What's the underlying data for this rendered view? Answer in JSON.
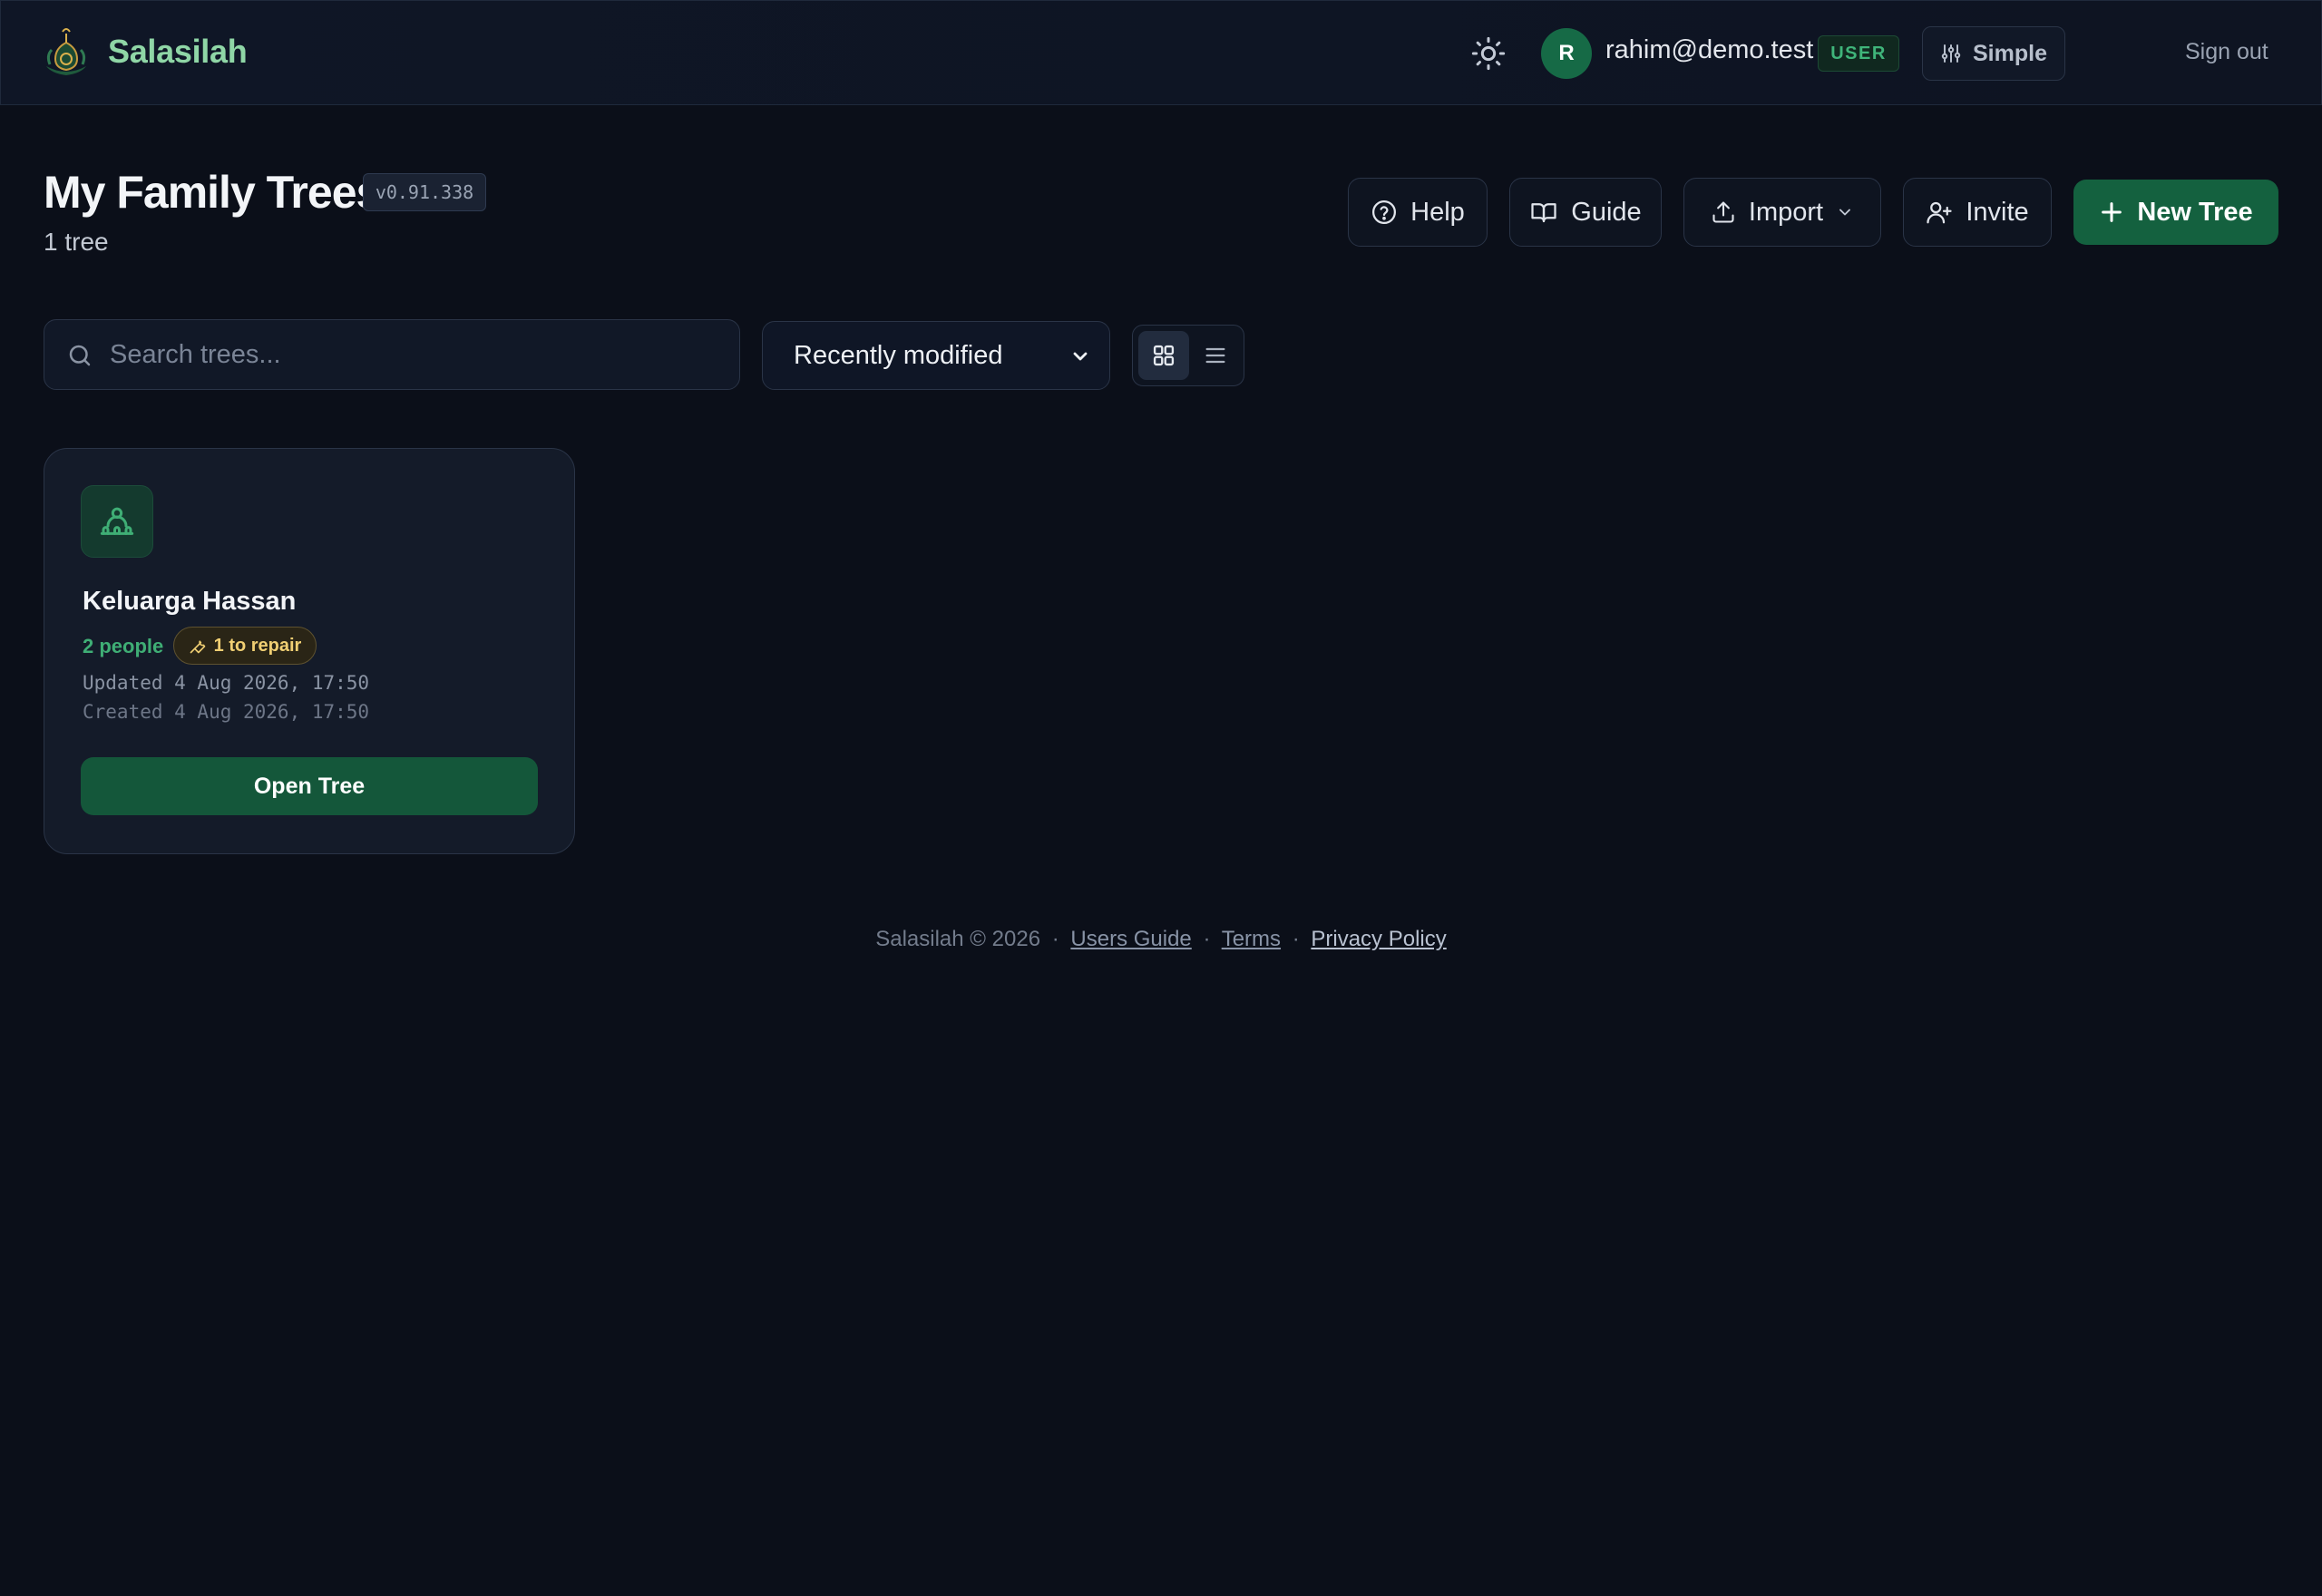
{
  "header": {
    "brand": "Salasilah",
    "user_initial": "R",
    "user_email": "rahim@demo.test",
    "role": "USER",
    "mode": "Simple",
    "sign_out": "Sign out"
  },
  "page": {
    "title": "My Family Trees",
    "version": "v0.91.338",
    "count": "1 tree"
  },
  "actions": {
    "help": "Help",
    "guide": "Guide",
    "import": "Import",
    "invite": "Invite",
    "new_tree": "New Tree"
  },
  "filters": {
    "search_placeholder": "Search trees...",
    "sort_selected": "Recently modified",
    "view_mode": "grid"
  },
  "trees": [
    {
      "name": "Keluarga Hassan",
      "people": "2 people",
      "repair": "1 to repair",
      "updated": "Updated 4 Aug 2026, 17:50",
      "created": "Created 4 Aug 2026, 17:50",
      "open_label": "Open Tree"
    }
  ],
  "footer": {
    "copyright": "Salasilah © 2026",
    "users_guide": "Users Guide",
    "terms": "Terms",
    "privacy": "Privacy Policy",
    "separator": "·"
  },
  "colors": {
    "background": "#0b0f19",
    "brand_green": "#8fd6a6",
    "primary_button": "#14613f",
    "repair_accent": "#f0cf73"
  },
  "icons": {
    "theme": "sun-icon",
    "mode": "sliders-icon",
    "help": "help-circle-icon",
    "guide": "book-icon",
    "import": "upload-icon",
    "invite": "user-plus-icon",
    "new_tree": "plus-icon",
    "search": "search-icon",
    "grid": "grid-icon",
    "list": "list-icon",
    "tree": "family-tree-icon",
    "repair": "wrench-icon"
  }
}
